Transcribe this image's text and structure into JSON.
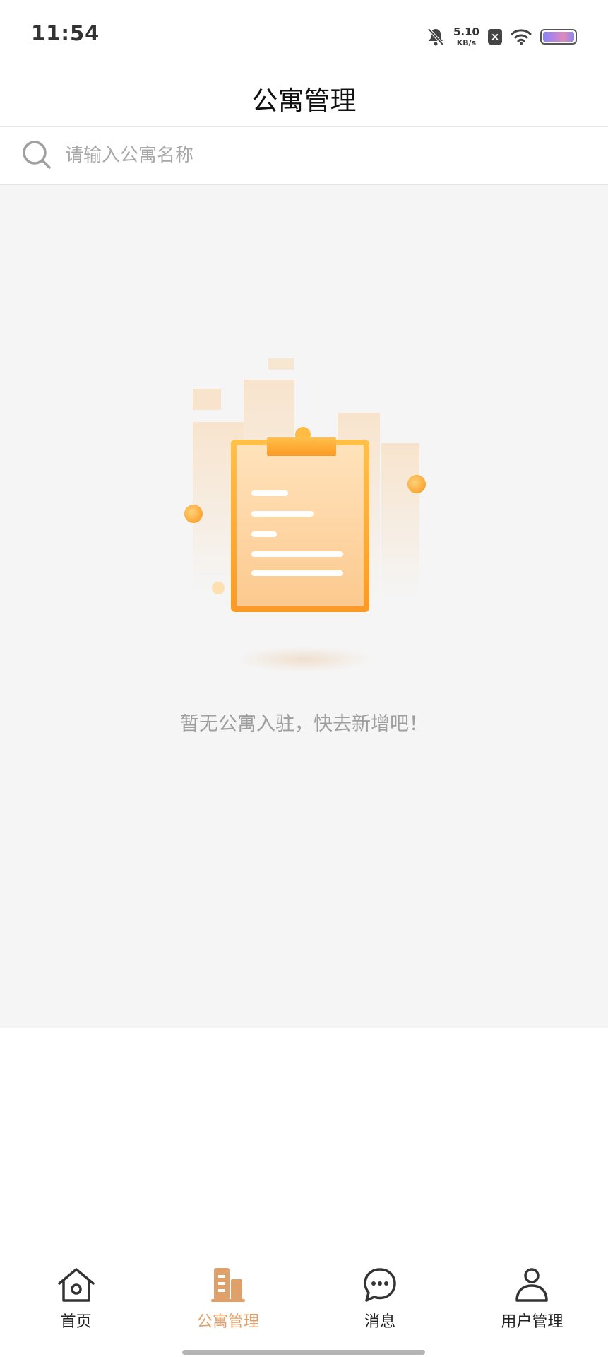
{
  "status_bar": {
    "time": "11:54",
    "net_speed_value": "5.10",
    "net_speed_unit": "KB/s",
    "sim_label": "×"
  },
  "header": {
    "title": "公寓管理"
  },
  "search": {
    "placeholder": "请输入公寓名称",
    "value": ""
  },
  "empty_state": {
    "message": "暂无公寓入驻，快去新增吧！"
  },
  "tabs": [
    {
      "label": "首页",
      "icon": "home-icon",
      "active": false
    },
    {
      "label": "公寓管理",
      "icon": "building-icon",
      "active": true
    },
    {
      "label": "消息",
      "icon": "message-icon",
      "active": false
    },
    {
      "label": "用户管理",
      "icon": "user-icon",
      "active": false
    }
  ],
  "colors": {
    "accent": "#e0a06a",
    "background": "#f5f5f5",
    "text_muted": "#9e9e9e"
  }
}
